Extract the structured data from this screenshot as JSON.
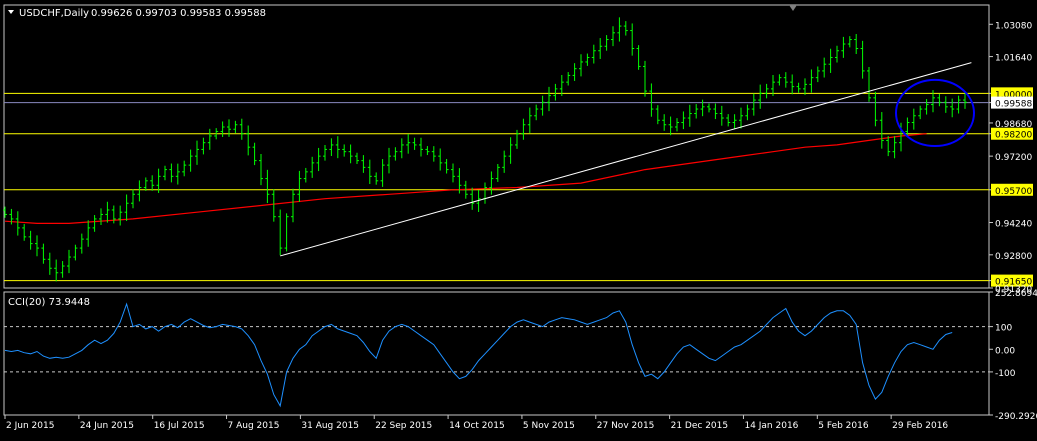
{
  "colors": {
    "background": "#000000",
    "frame": "#c8c8c8",
    "candle": "#00ff00",
    "moving_average": "#ff0000",
    "trendline": "#ffffff",
    "support_resistance": "#ffff00",
    "current_price_line": "#8a8ac0",
    "highlight_ellipse": "#0000ff",
    "cci_line": "#1e90ff",
    "cci_levels": "#c8c8c8",
    "text": "#ffffff"
  },
  "chart_data": [
    {
      "type": "candlestick",
      "title": "USDCHF,Daily",
      "ohlc_label": "0.99626 0.99703 0.99583 0.99588",
      "ylim": [
        0.9132,
        1.0394
      ],
      "y_ticks": [
        "1.03080",
        "1.01640",
        "1.00000",
        "0.99588",
        "0.98680",
        "0.98200",
        "0.97200",
        "0.95700",
        "0.94240",
        "0.92800",
        "0.91650",
        "0.91320"
      ],
      "horizontal_levels": [
        1.0,
        0.982,
        0.957,
        0.9165
      ],
      "current_price": 0.99588,
      "x_labels": [
        "2 Jun 2015",
        "24 Jun 2015",
        "16 Jul 2015",
        "7 Aug 2015",
        "31 Aug 2015",
        "22 Sep 2015",
        "14 Oct 2015",
        "5 Nov 2015",
        "27 Nov 2015",
        "21 Dec 2015",
        "14 Jan 2016",
        "5 Feb 2016",
        "29 Feb 2016"
      ],
      "series": [
        {
          "name": "",
          "kind": "close",
          "values": [
            0.946,
            0.944,
            0.94,
            0.936,
            0.933,
            0.931,
            0.926,
            0.922,
            0.92,
            0.923,
            0.927,
            0.931,
            0.935,
            0.94,
            0.944,
            0.946,
            0.948,
            0.944,
            0.947,
            0.951,
            0.955,
            0.958,
            0.961,
            0.959,
            0.963,
            0.966,
            0.963,
            0.965,
            0.968,
            0.972,
            0.975,
            0.978,
            0.981,
            0.983,
            0.985,
            0.984,
            0.986,
            0.982,
            0.976,
            0.97,
            0.962,
            0.955,
            0.945,
            0.931,
            0.945,
            0.955,
            0.962,
            0.965,
            0.969,
            0.972,
            0.975,
            0.977,
            0.975,
            0.974,
            0.972,
            0.97,
            0.967,
            0.963,
            0.961,
            0.968,
            0.972,
            0.974,
            0.977,
            0.978,
            0.977,
            0.975,
            0.974,
            0.972,
            0.969,
            0.966,
            0.963,
            0.959,
            0.955,
            0.951,
            0.953,
            0.958,
            0.962,
            0.967,
            0.972,
            0.977,
            0.982,
            0.986,
            0.99,
            0.993,
            0.996,
            0.999,
            1.002,
            1.005,
            1.008,
            1.011,
            1.014,
            1.016,
            1.019,
            1.021,
            1.024,
            1.027,
            1.03,
            1.028,
            1.02,
            1.012,
            1.001,
            0.993,
            0.988,
            0.986,
            0.985,
            0.987,
            0.989,
            0.991,
            0.993,
            0.994,
            0.993,
            0.991,
            0.989,
            0.987,
            0.988,
            0.99,
            0.993,
            0.997,
            1.0,
            1.002,
            1.005,
            1.007,
            1.005,
            1.003,
            1.002,
            1.004,
            1.007,
            1.01,
            1.013,
            1.016,
            1.019,
            1.022,
            1.024,
            1.02,
            1.01,
            0.998,
            0.988,
            0.979,
            0.974,
            0.978,
            0.983,
            0.987,
            0.99,
            0.993,
            0.995,
            0.998,
            0.996,
            0.994,
            0.993,
            0.997,
            0.996
          ]
        },
        {
          "name": "",
          "kind": "moving_average",
          "x": [
            0,
            5,
            10,
            20,
            30,
            40,
            50,
            60,
            70,
            80,
            90,
            100,
            105,
            110,
            115,
            120,
            125,
            130,
            135,
            140,
            144
          ],
          "values": [
            0.943,
            0.942,
            0.942,
            0.944,
            0.947,
            0.95,
            0.953,
            0.955,
            0.957,
            0.958,
            0.96,
            0.966,
            0.968,
            0.97,
            0.972,
            0.974,
            0.976,
            0.977,
            0.979,
            0.981,
            0.982
          ]
        },
        {
          "name": "",
          "kind": "trendline",
          "x": [
            43,
            151
          ],
          "values": [
            0.9275,
            1.0137
          ]
        }
      ]
    },
    {
      "type": "line",
      "title": "CCI(20) 73.9448",
      "ylim": [
        -290.2926,
        252.8694
      ],
      "y_ticks": [
        "252.8694",
        "100",
        "0.00",
        "-100",
        "-290.2926"
      ],
      "levels": [
        100,
        -100
      ],
      "series": [
        {
          "name": "",
          "values": [
            -5,
            -10,
            -5,
            -15,
            -20,
            -10,
            -30,
            -40,
            -35,
            -40,
            -35,
            -20,
            -5,
            20,
            40,
            25,
            40,
            70,
            120,
            200,
            100,
            110,
            90,
            100,
            80,
            100,
            110,
            95,
            120,
            135,
            120,
            105,
            95,
            100,
            110,
            105,
            100,
            90,
            60,
            20,
            -50,
            -110,
            -200,
            -250,
            -100,
            -40,
            0,
            20,
            60,
            80,
            100,
            110,
            90,
            80,
            70,
            60,
            30,
            -10,
            -40,
            40,
            80,
            100,
            110,
            100,
            80,
            60,
            40,
            20,
            -20,
            -60,
            -100,
            -130,
            -120,
            -90,
            -50,
            -20,
            10,
            40,
            70,
            100,
            120,
            130,
            120,
            110,
            100,
            120,
            130,
            140,
            135,
            130,
            120,
            110,
            120,
            130,
            140,
            160,
            170,
            120,
            20,
            -60,
            -120,
            -110,
            -130,
            -100,
            -60,
            -20,
            10,
            20,
            0,
            -20,
            -40,
            -50,
            -30,
            -10,
            10,
            20,
            40,
            60,
            80,
            110,
            140,
            160,
            180,
            120,
            80,
            60,
            80,
            110,
            140,
            160,
            170,
            170,
            150,
            110,
            -60,
            -160,
            -220,
            -190,
            -120,
            -60,
            -10,
            20,
            30,
            20,
            10,
            0,
            40,
            65,
            74
          ]
        }
      ]
    }
  ]
}
